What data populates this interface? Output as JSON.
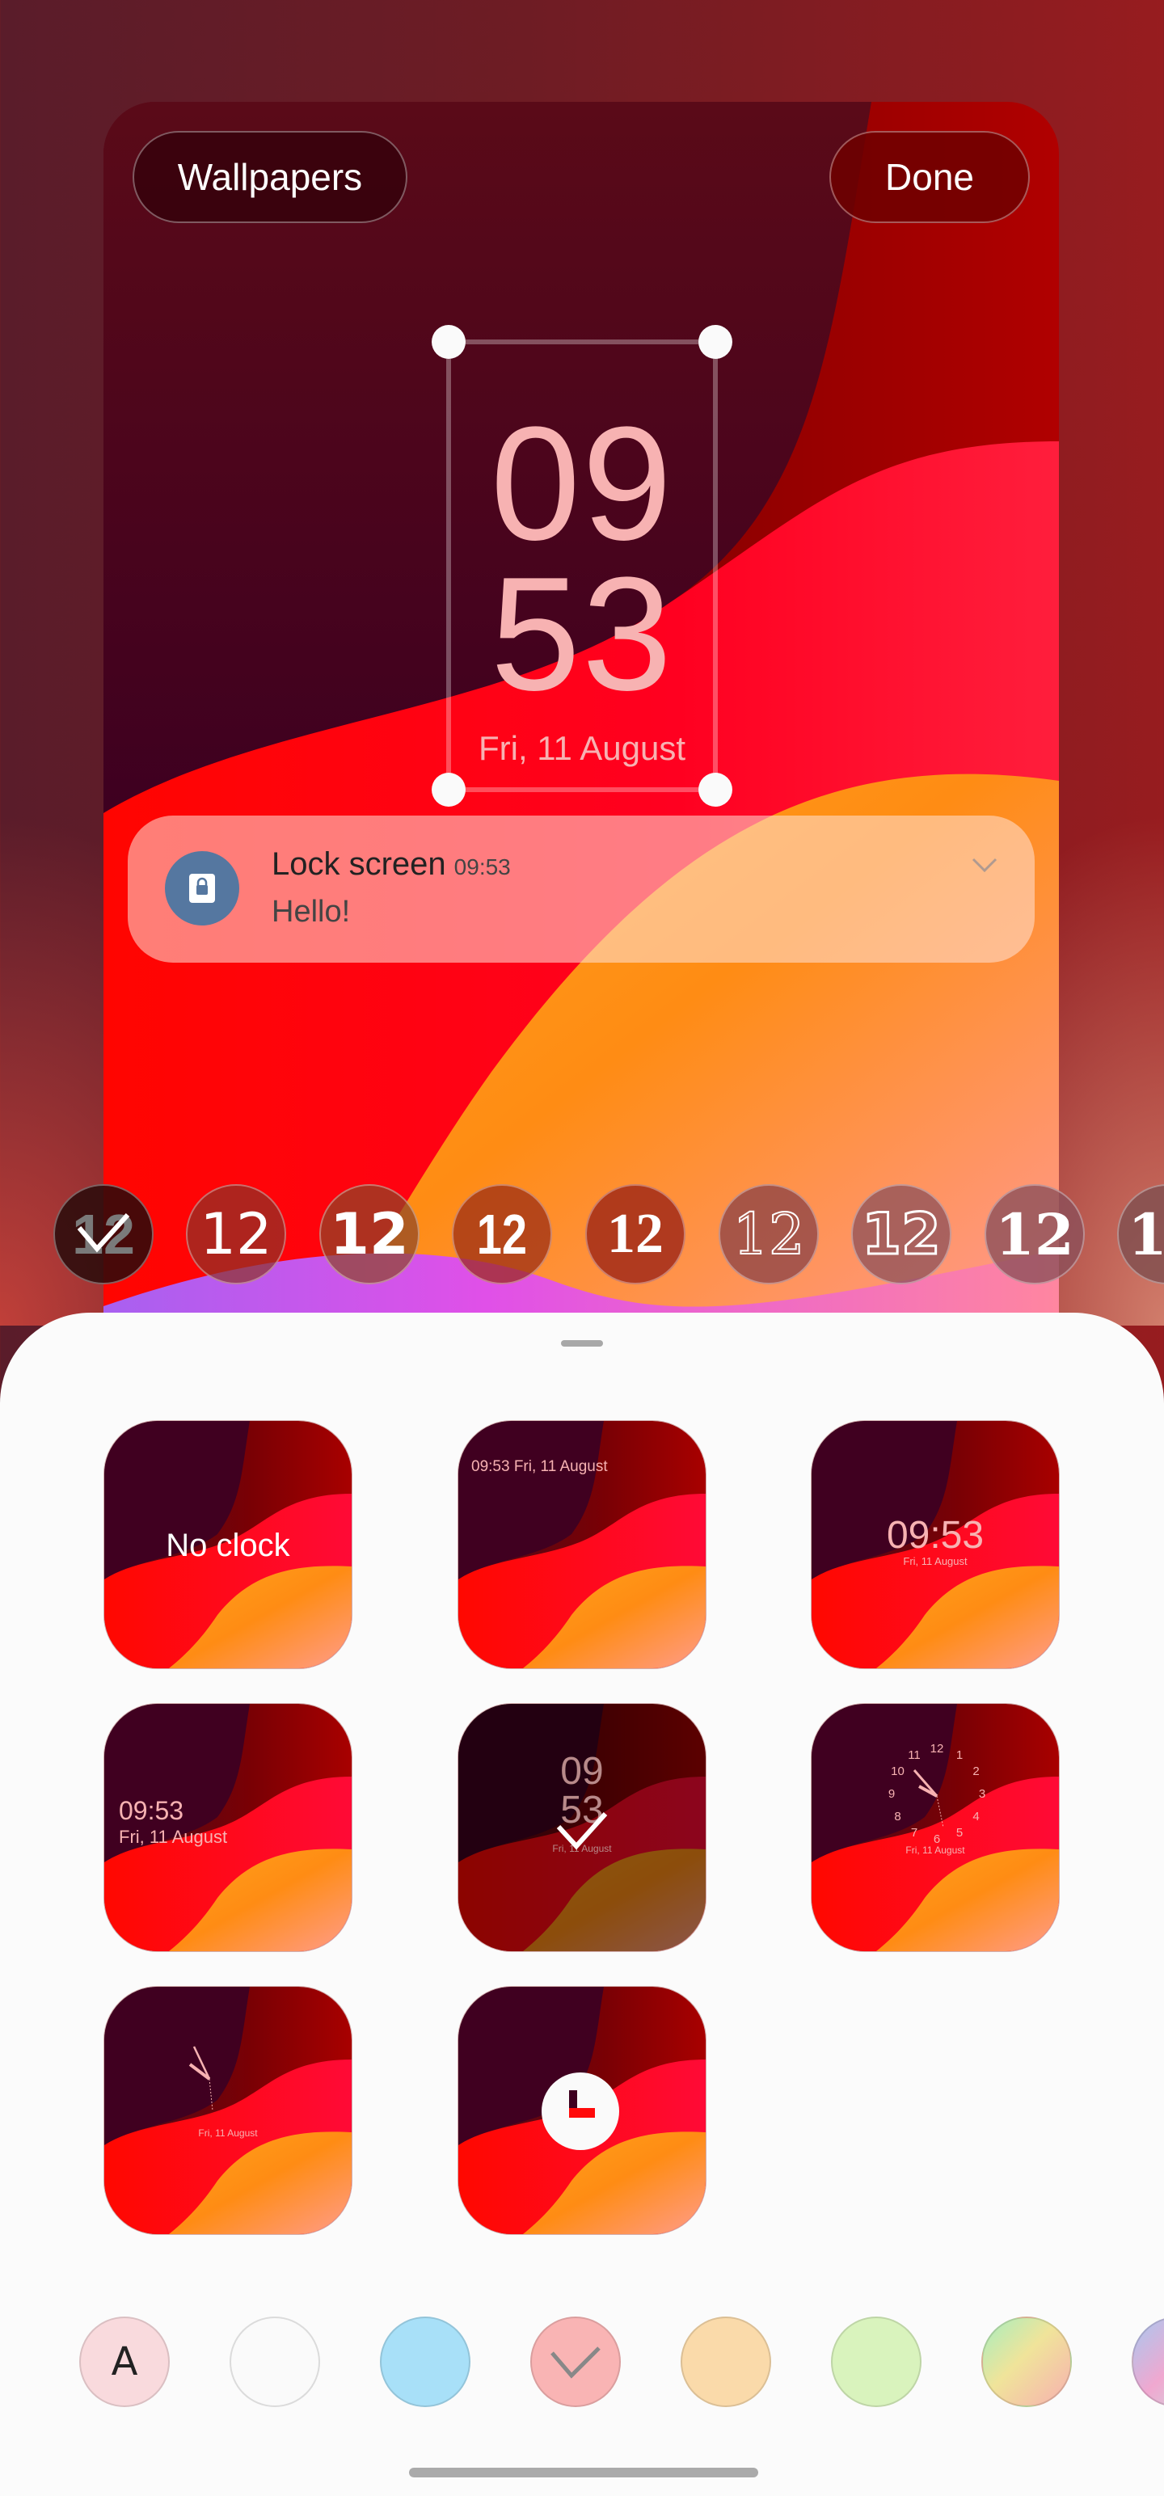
{
  "header": {
    "wallpapers_label": "Wallpapers",
    "done_label": "Done"
  },
  "lock_clock": {
    "hours": "09",
    "minutes": "53",
    "date": "Fri, 11 August",
    "text_color": "#f7b2b2"
  },
  "notification": {
    "app_icon": "lock-icon",
    "title": "Lock screen",
    "time": "09:53",
    "body": "Hello!",
    "expand_icon": "chevron-down-icon"
  },
  "font_styles": {
    "sample": "12",
    "selected_index": 0,
    "items": [
      {
        "name": "default",
        "selected": true
      },
      {
        "name": "rounded"
      },
      {
        "name": "bold-rounded"
      },
      {
        "name": "condensed"
      },
      {
        "name": "serif"
      },
      {
        "name": "sketch"
      },
      {
        "name": "outline-lines"
      },
      {
        "name": "stencil"
      },
      {
        "name": "slab"
      }
    ]
  },
  "clock_styles": [
    {
      "name": "no-clock",
      "label": "No clock"
    },
    {
      "name": "inline-top",
      "label": "09:53 Fri, 11 August"
    },
    {
      "name": "centered-horizontal",
      "time": "09:53",
      "date": "Fri, 11 August"
    },
    {
      "name": "left-aligned",
      "time": "09:53",
      "date": "Fri, 11 August"
    },
    {
      "name": "vertical-stacked",
      "hours": "09",
      "minutes": "53",
      "date": "Fri, 11 August",
      "selected": true
    },
    {
      "name": "analog-numbers",
      "numbers": [
        "12",
        "1",
        "2",
        "3",
        "4",
        "5",
        "6",
        "7",
        "8",
        "9",
        "10",
        "11"
      ],
      "date": "Fri, 11 August"
    },
    {
      "name": "analog-hands",
      "date": "Fri, 11 August"
    },
    {
      "name": "icon-clock"
    }
  ],
  "colors": {
    "selected_index": 3,
    "auto_label": "A",
    "swatches": [
      "#f9dadd",
      "#fafafa",
      "#a8e0f8",
      "#f9b4b4",
      "#fadaaa",
      "#d9f3bd",
      "gradient-rainbow",
      "gradient-pastel"
    ]
  },
  "accent": {
    "notification_icon_bg": "#5577a0"
  }
}
